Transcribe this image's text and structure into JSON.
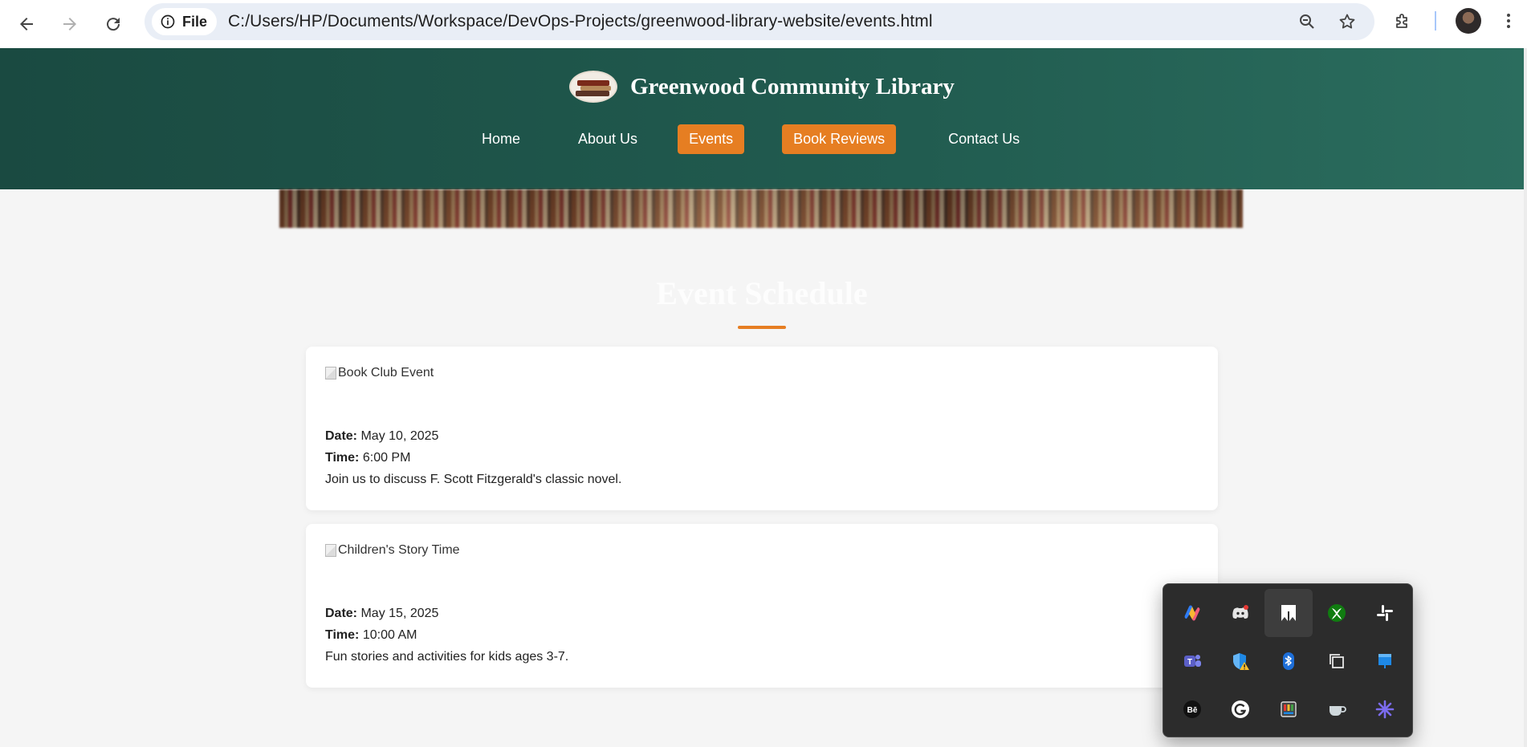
{
  "browser": {
    "chip_label": "File",
    "url": "C:/Users/HP/Documents/Workspace/DevOps-Projects/greenwood-library-website/events.html"
  },
  "site": {
    "title": "Greenwood Community Library",
    "nav": [
      {
        "label": "Home",
        "active": false
      },
      {
        "label": "About Us",
        "active": false
      },
      {
        "label": "Events",
        "active": true
      },
      {
        "label": "Book Reviews",
        "active": true
      },
      {
        "label": "Contact Us",
        "active": false
      }
    ],
    "accent": "#e67e22",
    "header_color": "#1f5549"
  },
  "events": {
    "title": "Event Schedule",
    "date_label": "Date:",
    "time_label": "Time:",
    "items": [
      {
        "image_alt": "Book Club Event",
        "date": "May 10, 2025",
        "time": "6:00 PM",
        "description": "Join us to discuss F. Scott Fitzgerald's classic novel."
      },
      {
        "image_alt": "Children's Story Time",
        "date": "May 15, 2025",
        "time": "10:00 AM",
        "description": "Fun stories and activities for kids ages 3-7."
      }
    ]
  },
  "tray": {
    "icons": [
      "copilot-icon",
      "discord-icon",
      "bookmark-app-icon",
      "xbox-icon",
      "slack-icon",
      "teams-icon",
      "defender-warning-icon",
      "bluetooth-icon",
      "copy-windows-icon",
      "blue-app-icon",
      "behance-icon",
      "grammarly-icon",
      "color-picker-icon",
      "coffee-cup-icon",
      "sparkle-app-icon"
    ]
  }
}
